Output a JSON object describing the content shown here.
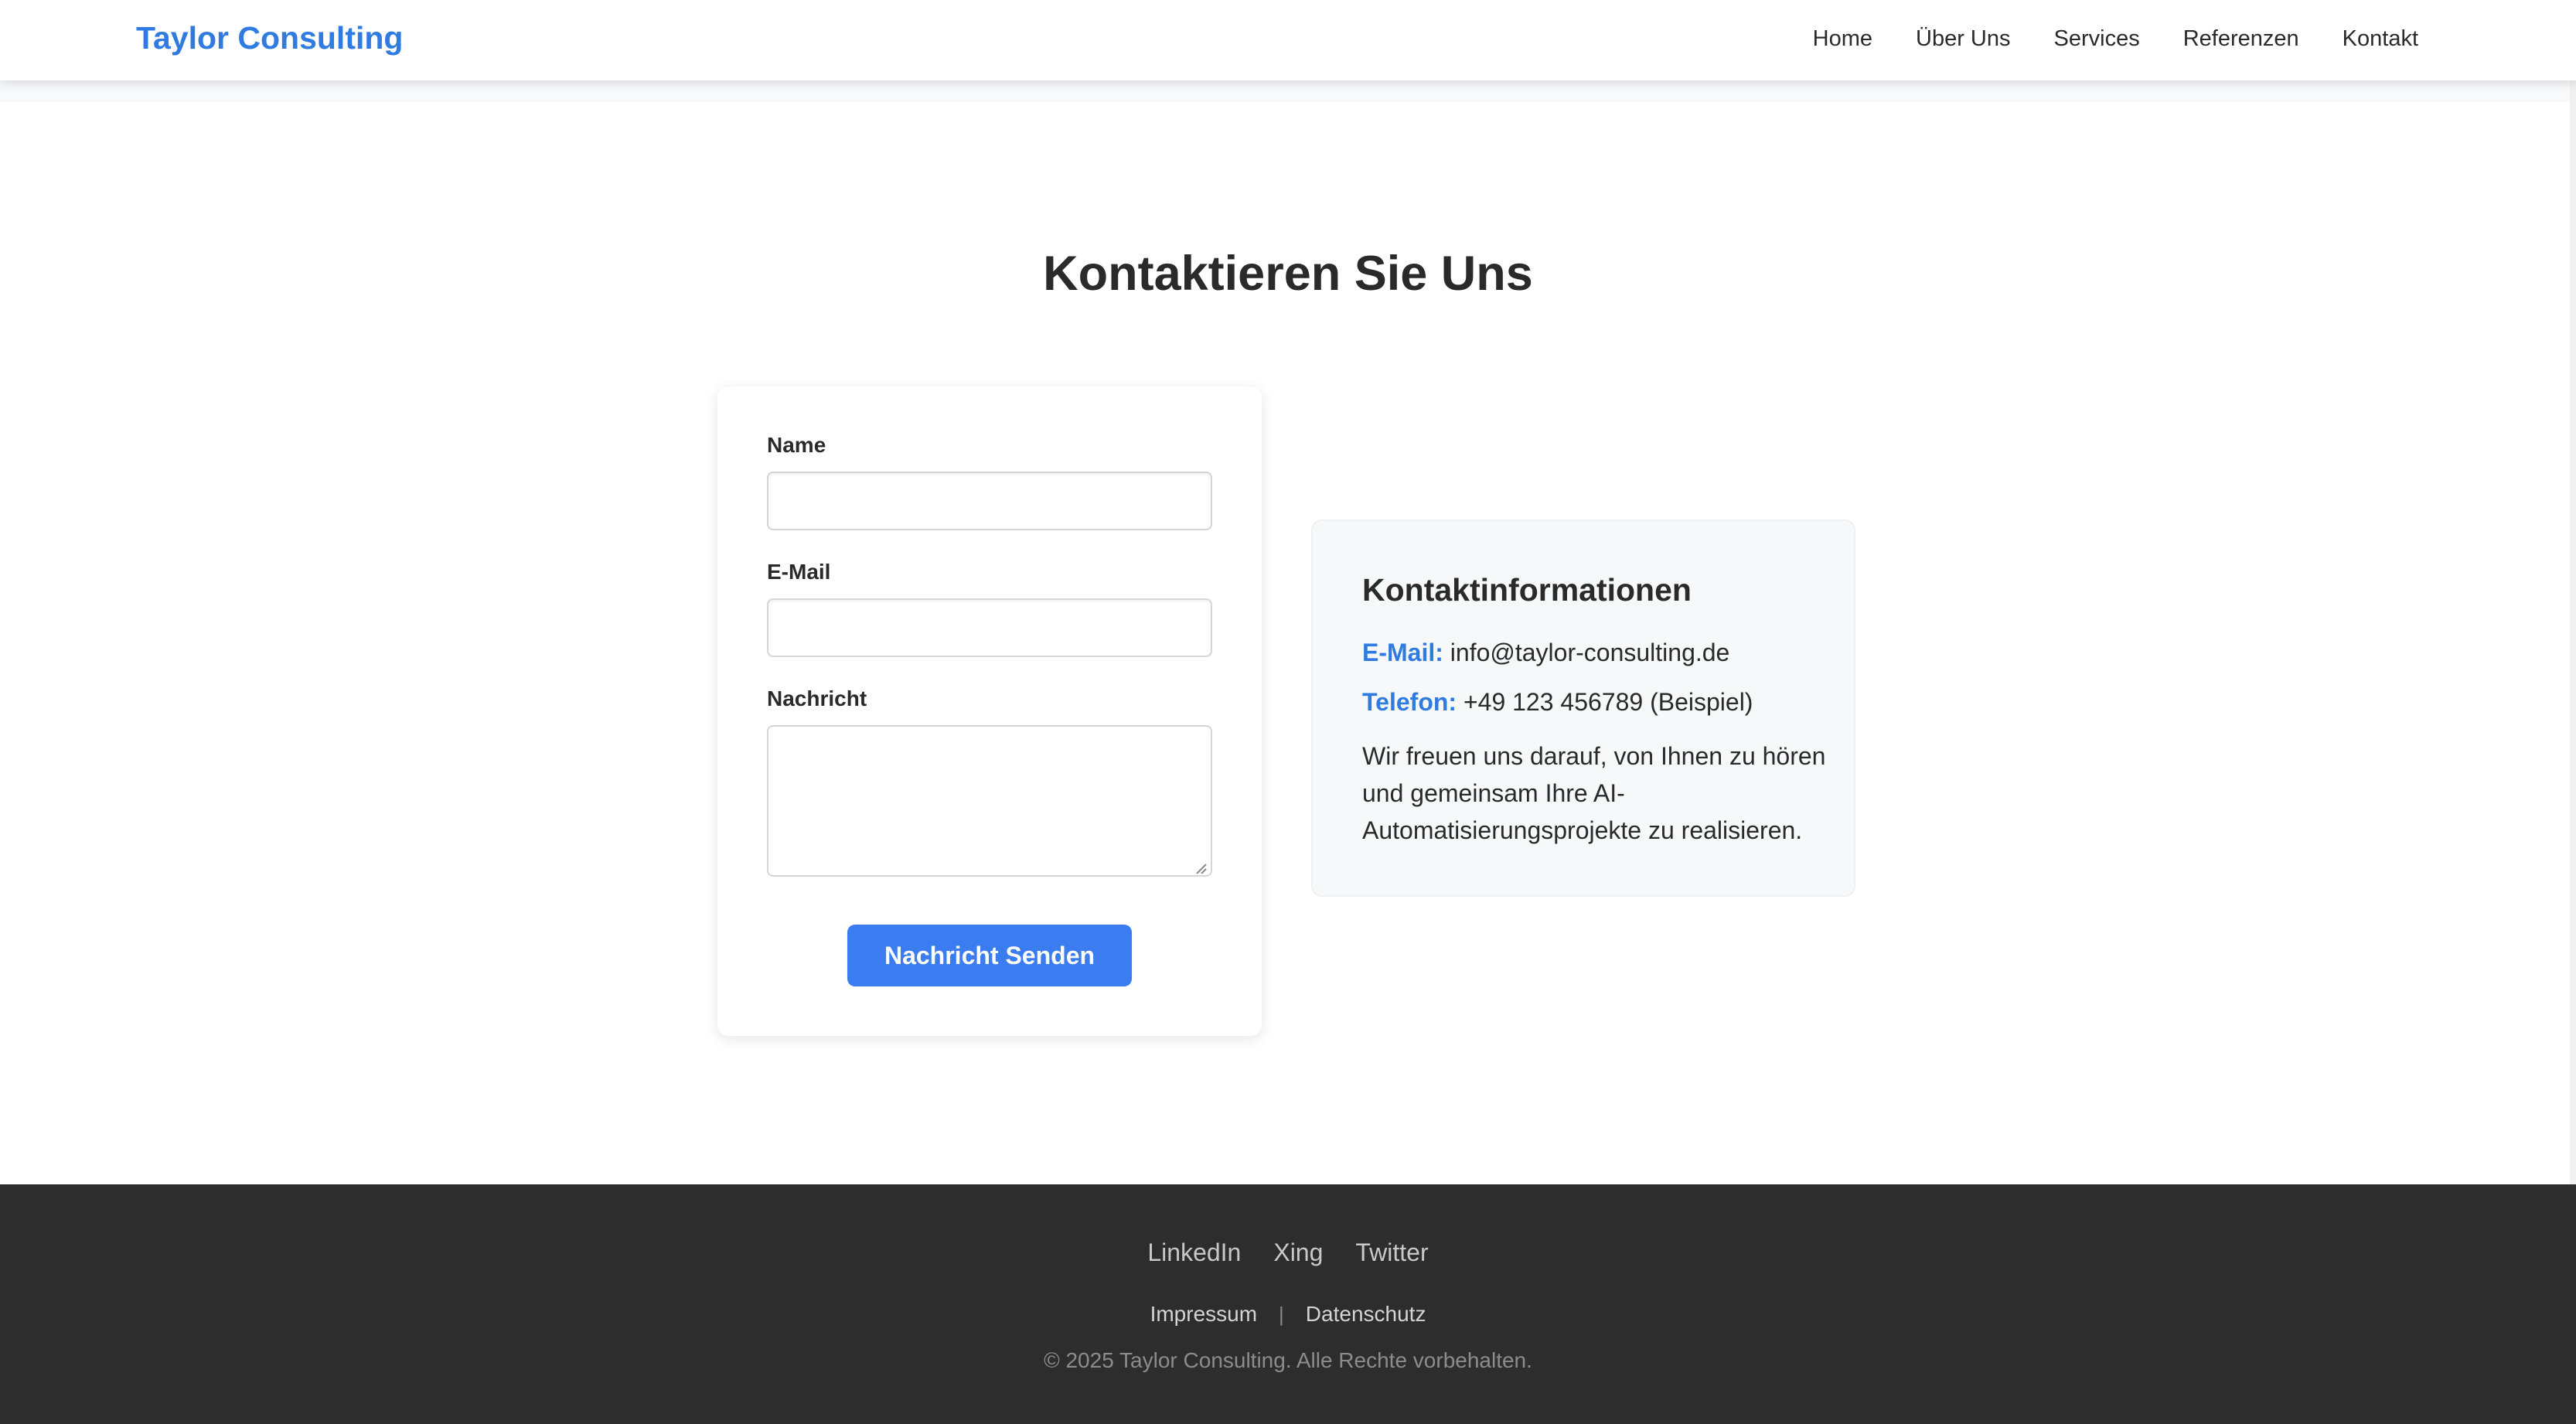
{
  "header": {
    "logo": "Taylor Consulting",
    "nav": [
      "Home",
      "Über Uns",
      "Services",
      "Referenzen",
      "Kontakt"
    ]
  },
  "main": {
    "title": "Kontaktieren Sie Uns",
    "form": {
      "name_label": "Name",
      "name_value": "",
      "email_label": "E-Mail",
      "email_value": "",
      "message_label": "Nachricht",
      "message_value": "",
      "submit_label": "Nachricht Senden"
    },
    "info": {
      "title": "Kontaktinformationen",
      "email_key": "E-Mail:",
      "email_value": "info@taylor-consulting.de",
      "phone_key": "Telefon:",
      "phone_value": "+49 123 456789 (Beispiel)",
      "text": "Wir freuen uns darauf, von Ihnen zu hören und gemeinsam Ihre AI-Automatisierungsprojekte zu realisieren."
    }
  },
  "footer": {
    "social": [
      "LinkedIn",
      "Xing",
      "Twitter"
    ],
    "legal": [
      "Impressum",
      "Datenschutz"
    ],
    "separator": "|",
    "copyright": "© 2025 Taylor Consulting. Alle Rechte vorbehalten."
  },
  "colors": {
    "accent": "#2f7be0",
    "button": "#3b7cf0",
    "footer_bg": "#2d2d2d"
  },
  "icons": {
    "textarea_resize": "resize-grip-icon"
  }
}
